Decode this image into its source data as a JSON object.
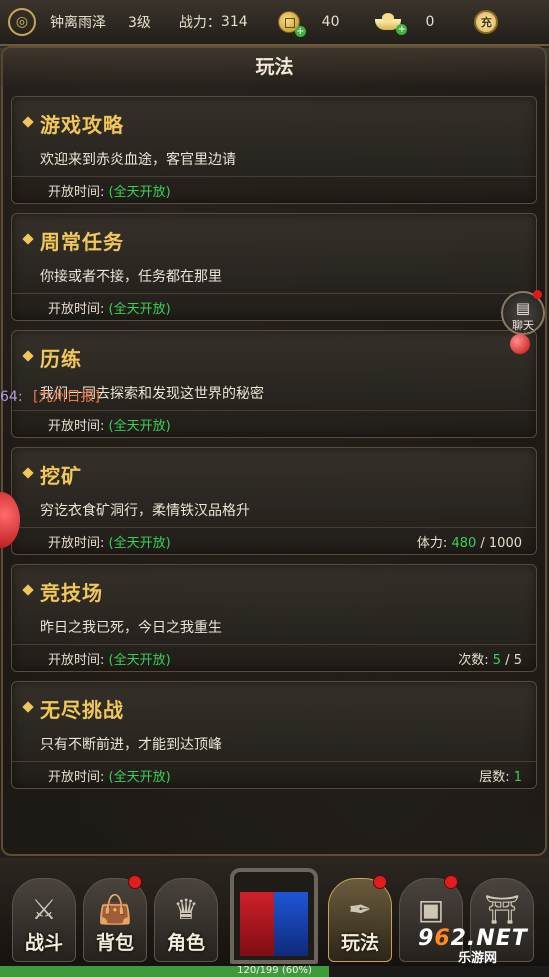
{
  "topbar": {
    "player_name": "钟离雨泽",
    "level": "3级",
    "power_label": "战力：",
    "power_value": "314",
    "coin_value": "40",
    "ingot_value": "0",
    "charge_label": "充"
  },
  "panel": {
    "title": "玩法"
  },
  "cards": [
    {
      "title": "游戏攻略",
      "desc": "欢迎来到赤炎血途，客官里边请",
      "open_label": "开放时间:",
      "open_value": "(全天开放)"
    },
    {
      "title": "周常任务",
      "desc": "你接或者不接，任务都在那里",
      "open_label": "开放时间:",
      "open_value": "(全天开放)"
    },
    {
      "title": "历练",
      "desc": "我们一同去探索和发现这世界的秘密",
      "open_label": "开放时间:",
      "open_value": "(全天开放)"
    },
    {
      "title": "挖矿",
      "desc": "穷讫衣食矿洞行，柔情铁汉品格升",
      "open_label": "开放时间:",
      "open_value": "(全天开放)",
      "stat_label": "体力:",
      "stat_value": "480",
      "stat_max": " / 1000"
    },
    {
      "title": "竞技场",
      "desc": "昨日之我已死，今日之我重生",
      "open_label": "开放时间:",
      "open_value": "(全天开放)",
      "stat_label": "次数:",
      "stat_value": "5",
      "stat_max": " / 5"
    },
    {
      "title": "无尽挑战",
      "desc": "只有不断前进，才能到达顶峰",
      "open_label": "开放时间:",
      "open_value": "(全天开放)",
      "stat_label": "层数:",
      "stat_value": "1",
      "stat_max": ""
    }
  ],
  "chat": {
    "label": "聊天"
  },
  "scroll_message": {
    "prefix": "64:",
    "channel": "[九州日报]",
    "text": ""
  },
  "nav": [
    {
      "label": "战斗",
      "icon": "crossed-swords-icon",
      "glyph": "⚔",
      "badge": false
    },
    {
      "label": "背包",
      "icon": "bag-icon",
      "glyph": "👜",
      "badge": true
    },
    {
      "label": "角色",
      "icon": "helmet-icon",
      "glyph": "♛",
      "badge": false
    },
    {
      "label": "玩法",
      "icon": "quill-icon",
      "glyph": "✒",
      "badge": true,
      "active": true
    },
    {
      "label": "",
      "icon": "chest-icon",
      "glyph": "▣",
      "badge": true
    },
    {
      "label": "",
      "icon": "temple-icon",
      "glyph": "⛩",
      "badge": false
    }
  ],
  "exp": {
    "text": "120/199 (60%)",
    "percent": 60
  },
  "watermark": {
    "brand_pre": "9",
    "brand_mid": "6",
    "brand_post": "2.NET",
    "sub": "乐游网"
  },
  "colors": {
    "accent_gold": "#f1c75a",
    "open_green": "#3ccf56"
  }
}
